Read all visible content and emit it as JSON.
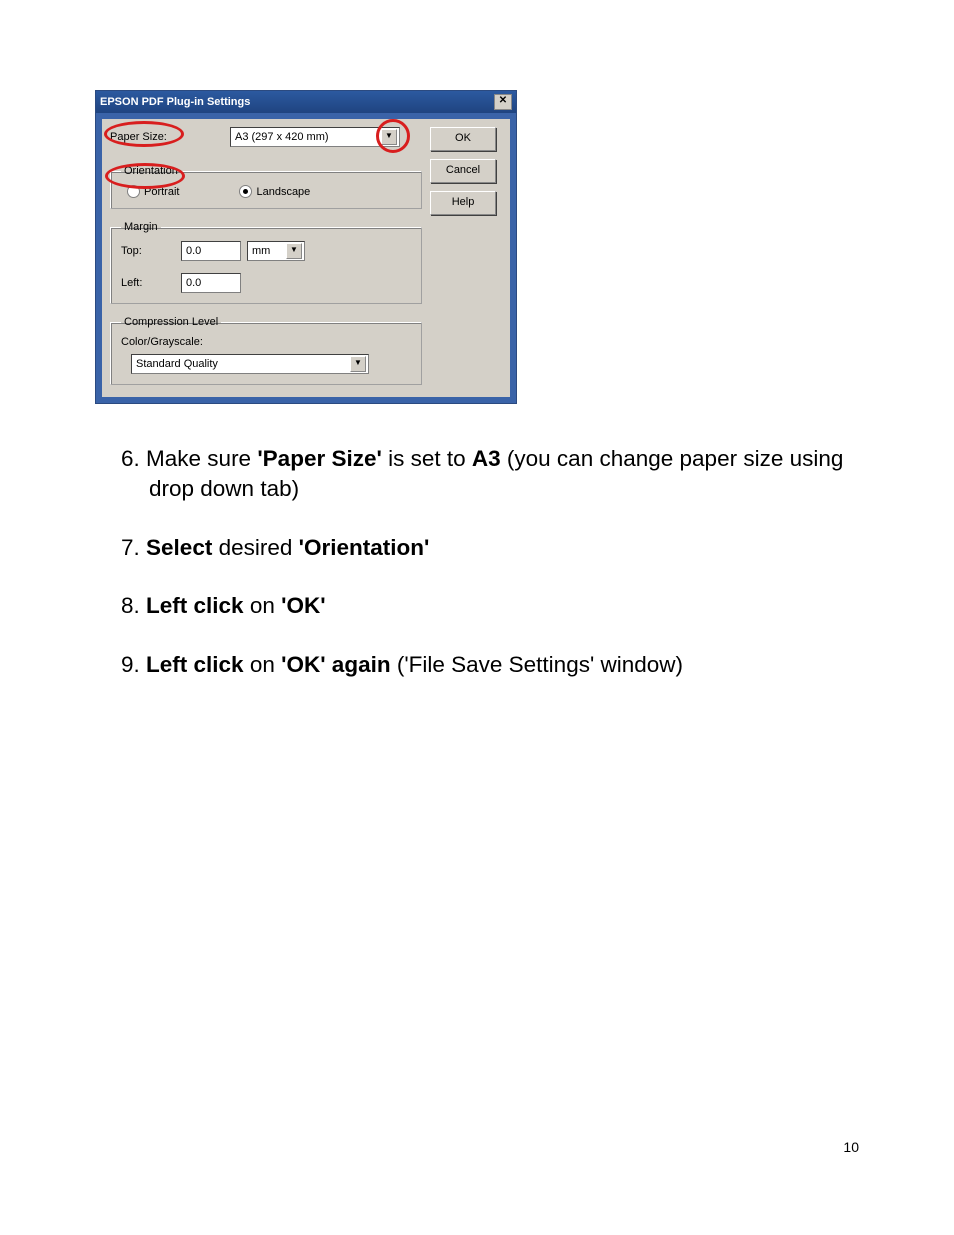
{
  "dialog": {
    "title": "EPSON PDF Plug-in Settings",
    "paperSizeLabel": "Paper Size:",
    "paperSizeValue": "A3 (297 x 420 mm)",
    "orientation": {
      "legend": "Orientation",
      "portrait": "Portrait",
      "landscape": "Landscape"
    },
    "margin": {
      "legend": "Margin",
      "topLabel": "Top:",
      "topValue": "0.0",
      "unit": "mm",
      "leftLabel": "Left:",
      "leftValue": "0.0"
    },
    "compression": {
      "legend": "Compression Level",
      "colorLabel": "Color/Grayscale:",
      "value": "Standard Quality"
    },
    "buttons": {
      "ok": "OK",
      "cancel": "Cancel",
      "help": "Help"
    }
  },
  "steps": {
    "s6_num": "6. ",
    "s6_a": "Make sure ",
    "s6_b": "'Paper Size'",
    "s6_c": " is set to ",
    "s6_d": "A3",
    "s6_e": " (you can change paper size using drop down tab)",
    "s7_num": "7. ",
    "s7_a": "Select",
    "s7_b": " desired ",
    "s7_c": "'Orientation'",
    "s8_num": "8. ",
    "s8_a": "Left click",
    "s8_b": " on ",
    "s8_c": "'OK'",
    "s9_num": "9. ",
    "s9_a": "Left click",
    "s9_b": " on ",
    "s9_c": "'OK' again",
    "s9_d": " ('File Save Settings' window)"
  },
  "pageNumber": "10"
}
